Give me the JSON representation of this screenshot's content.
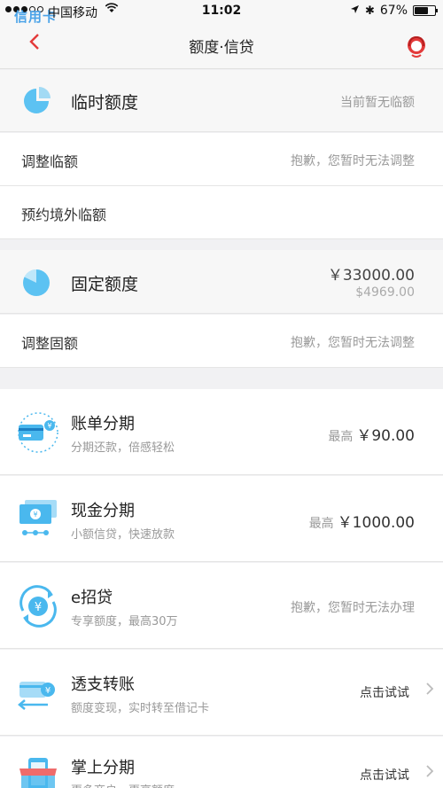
{
  "status_bar": {
    "carrier": "中国移动",
    "time": "11:02",
    "battery": "67%",
    "battery_level": 0.67,
    "app_badge": "信用卡"
  },
  "nav": {
    "back_icon": "chevron-left-icon",
    "title": "额度·信贷",
    "service_icon": "customer-service-icon"
  },
  "temp_credit": {
    "title": "临时额度",
    "status": "当前暂无临额",
    "rows": [
      {
        "label": "调整临额",
        "value": "抱歉，您暂时无法调整"
      },
      {
        "label": "预约境外临额",
        "value": ""
      }
    ]
  },
  "fixed_credit": {
    "title": "固定额度",
    "amount_cny": "￥33000.00",
    "amount_usd": "$4969.00",
    "rows": [
      {
        "label": "调整固额",
        "value": "抱歉，您暂时无法调整"
      }
    ]
  },
  "products": [
    {
      "icon": "bill-installment-icon",
      "title": "账单分期",
      "subtitle": "分期还款，倍感轻松",
      "prefix": "最高",
      "value": "￥90.00"
    },
    {
      "icon": "cash-installment-icon",
      "title": "现金分期",
      "subtitle": "小额信贷，快速放款",
      "prefix": "最高",
      "value": "￥1000.00"
    },
    {
      "icon": "e-loan-icon",
      "title": "e招贷",
      "subtitle": "专享额度，最高30万",
      "prefix": "",
      "value": "抱歉，您暂时无法办理"
    },
    {
      "icon": "overdraft-transfer-icon",
      "title": "透支转账",
      "subtitle": "额度变现，实时转至借记卡",
      "prefix": "",
      "value": "点击试试"
    },
    {
      "icon": "mobile-installment-icon",
      "title": "掌上分期",
      "subtitle": "更多商户，更高额度",
      "prefix": "",
      "value": "点击试试"
    }
  ],
  "colors": {
    "accent_red": "#e33a3a",
    "icon_blue": "#4ab8ee",
    "background": "#f1f1f3"
  }
}
